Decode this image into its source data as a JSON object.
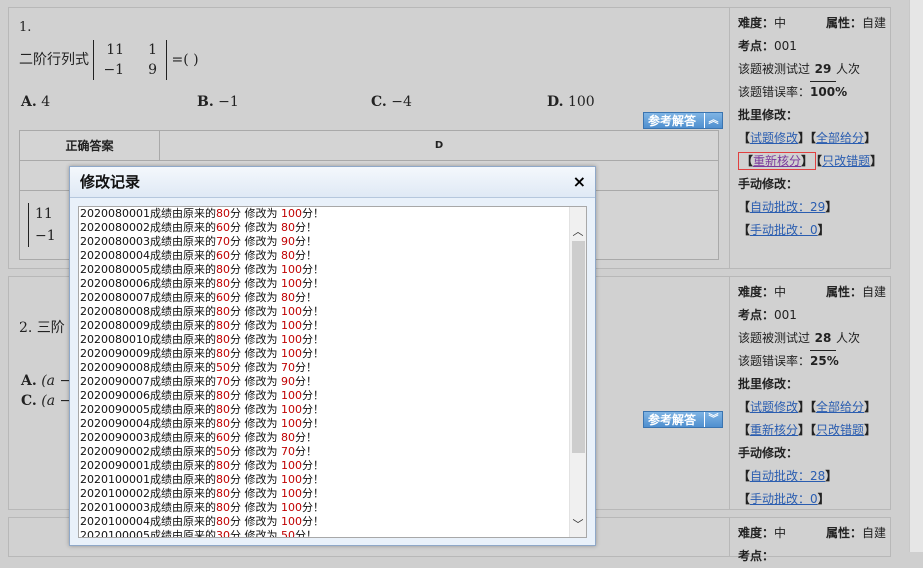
{
  "questions": [
    {
      "number": "1.",
      "stem_prefix": "二阶行列式",
      "matrix": [
        [
          "11",
          "1"
        ],
        [
          "−1",
          "9"
        ]
      ],
      "stem_suffix": "=( )",
      "options": [
        {
          "letter": "A.",
          "text": "4"
        },
        {
          "letter": "B.",
          "text": "−1"
        },
        {
          "letter": "C.",
          "text": "−4"
        },
        {
          "letter": "D.",
          "text": "100"
        }
      ],
      "ref_button": "参考解答",
      "ref_toggle": "︽",
      "answer_header": "正确答案",
      "answer_value": "D",
      "partial_matrix": [
        "11",
        "−1"
      ],
      "side": {
        "difficulty_label": "难度：",
        "difficulty": "中",
        "attr_label": "属性：",
        "attr": "自建",
        "point_label": "考点：",
        "point": "001",
        "tested_prefix": "该题被测试过",
        "tested_count": "29",
        "tested_suffix": "人次",
        "error_label": "该题错误率：",
        "error_rate": "100%",
        "batch_label": "批里修改：",
        "btn_edit": "试题修改",
        "btn_all": "全部给分",
        "btn_recheck": "重新核分",
        "btn_wrongonly": "只改错题",
        "manual_label": "手动修改：",
        "auto_label": "自动批改：29",
        "manual_link": "手动批改：0"
      }
    },
    {
      "number": "2.",
      "stem_prefix": "三阶",
      "options": [
        {
          "letter": "A.",
          "text": "(a −"
        },
        {
          "letter": "C.",
          "text": "(a −"
        }
      ],
      "ref_button": "参考解答",
      "ref_toggle": "︾",
      "side": {
        "difficulty_label": "难度：",
        "difficulty": "中",
        "attr_label": "属性：",
        "attr": "自建",
        "point_label": "考点：",
        "point": "001",
        "tested_prefix": "该题被测试过",
        "tested_count": "28",
        "tested_suffix": "人次",
        "error_label": "该题错误率：",
        "error_rate": "25%",
        "batch_label": "批里修改：",
        "btn_edit": "试题修改",
        "btn_all": "全部给分",
        "btn_recheck": "重新核分",
        "btn_wrongonly": "只改错题",
        "manual_label": "手动修改：",
        "auto_label": "自动批改：28",
        "manual_link": "手动批改：0"
      }
    },
    {
      "side": {
        "difficulty_label": "难度：",
        "difficulty": "中",
        "attr_label": "属性：",
        "attr": "自建",
        "point_label": "考点："
      }
    }
  ],
  "modal": {
    "title": "修改记录",
    "close": "×",
    "text_a": "成绩由原来的",
    "text_b": "分 修改为",
    "text_c": "分！",
    "records": [
      {
        "id": "2020080001",
        "from": "80",
        "to": "100"
      },
      {
        "id": "2020080002",
        "from": "60",
        "to": "80"
      },
      {
        "id": "2020080003",
        "from": "70",
        "to": "90"
      },
      {
        "id": "2020080004",
        "from": "60",
        "to": "80"
      },
      {
        "id": "2020080005",
        "from": "80",
        "to": "100"
      },
      {
        "id": "2020080006",
        "from": "80",
        "to": "100"
      },
      {
        "id": "2020080007",
        "from": "60",
        "to": "80"
      },
      {
        "id": "2020080008",
        "from": "80",
        "to": "100"
      },
      {
        "id": "2020080009",
        "from": "80",
        "to": "100"
      },
      {
        "id": "2020080010",
        "from": "80",
        "to": "100"
      },
      {
        "id": "2020090009",
        "from": "80",
        "to": "100"
      },
      {
        "id": "2020090008",
        "from": "50",
        "to": "70"
      },
      {
        "id": "2020090007",
        "from": "70",
        "to": "90"
      },
      {
        "id": "2020090006",
        "from": "80",
        "to": "100"
      },
      {
        "id": "2020090005",
        "from": "80",
        "to": "100"
      },
      {
        "id": "2020090004",
        "from": "80",
        "to": "100"
      },
      {
        "id": "2020090003",
        "from": "60",
        "to": "80"
      },
      {
        "id": "2020090002",
        "from": "50",
        "to": "70"
      },
      {
        "id": "2020090001",
        "from": "80",
        "to": "100"
      },
      {
        "id": "2020100001",
        "from": "80",
        "to": "100"
      },
      {
        "id": "2020100002",
        "from": "80",
        "to": "100"
      },
      {
        "id": "2020100003",
        "from": "80",
        "to": "100"
      },
      {
        "id": "2020100004",
        "from": "80",
        "to": "100"
      },
      {
        "id": "2020100005",
        "from": "30",
        "to": "50"
      }
    ]
  }
}
